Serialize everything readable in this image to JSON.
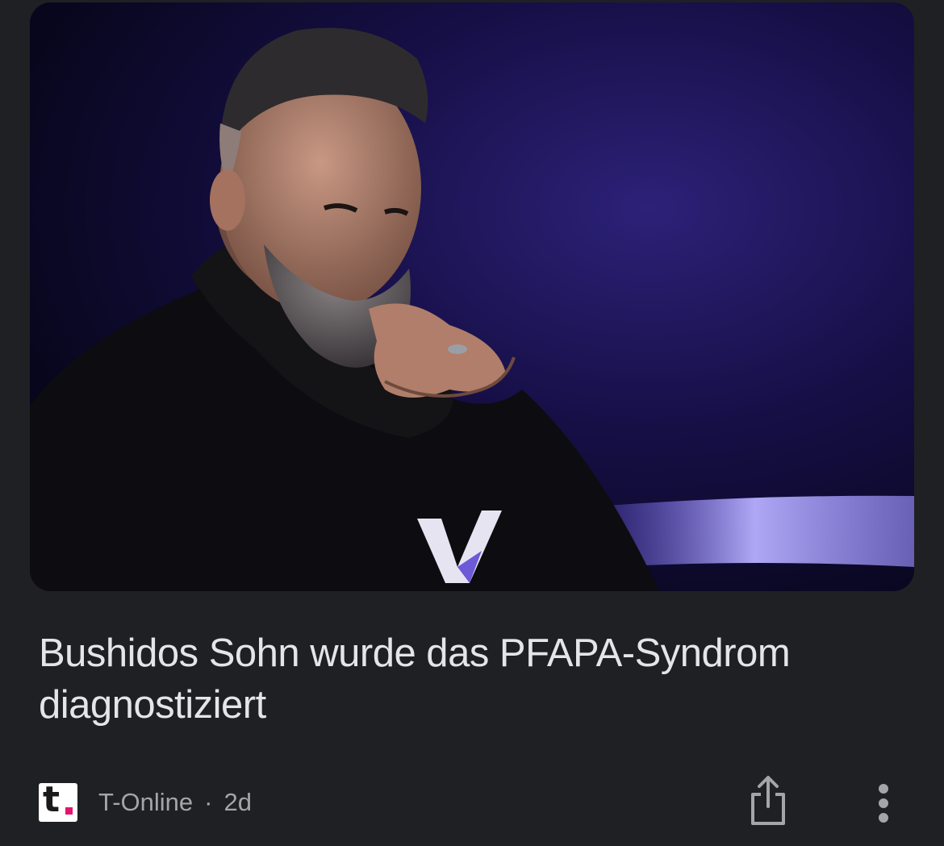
{
  "article": {
    "image_alt": "",
    "headline": "Bushidos Sohn wurde das PFAPA-Syndrom diagnostiziert",
    "source": "T-Online",
    "separator": "·",
    "age": "2d"
  },
  "logo": {
    "letter": "t",
    "dot_color": "#e8116e"
  },
  "icons": {
    "share": "share-icon",
    "more": "more-vertical-icon"
  },
  "colors": {
    "background": "#1f2023",
    "headline": "#e4e5e8",
    "meta": "#a3a5aa"
  }
}
